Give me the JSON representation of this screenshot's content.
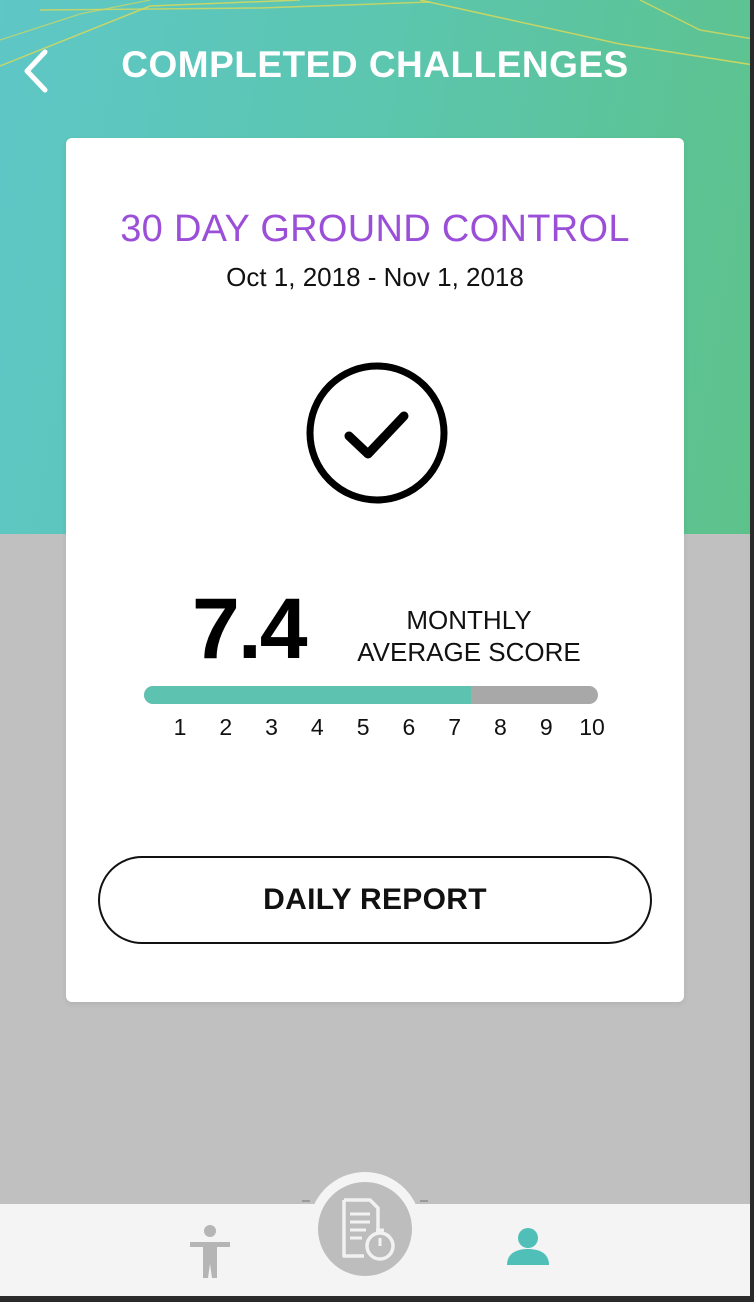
{
  "header": {
    "title": "COMPLETED CHALLENGES",
    "back_icon": "chevron-left-icon"
  },
  "challenge": {
    "title": "30 DAY GROUND CONTROL",
    "date_range": "Oct 1, 2018 - Nov 1, 2018",
    "status_icon": "check-circle-icon"
  },
  "score": {
    "value": "7.4",
    "label_line1": "MONTHLY",
    "label_line2": "AVERAGE SCORE",
    "progress_fraction": 0.72,
    "scale_min": 1,
    "scale_max": 10,
    "scale_labels": [
      "1",
      "2",
      "3",
      "4",
      "5",
      "6",
      "7",
      "8",
      "9",
      "10"
    ]
  },
  "actions": {
    "daily_report_label": "DAILY REPORT"
  },
  "bottom_nav": {
    "items": [
      {
        "icon": "body-pose-icon",
        "active": false
      },
      {
        "icon": "report-timer-icon",
        "active": false
      },
      {
        "icon": "profile-icon",
        "active": true
      }
    ]
  },
  "colors": {
    "accent_teal": "#5ec2b0",
    "title_purple": "#9b4fd8",
    "track_gray": "#a8a8a8",
    "active_nav": "#4fbfb8",
    "inactive_nav": "#b5b5b5"
  }
}
